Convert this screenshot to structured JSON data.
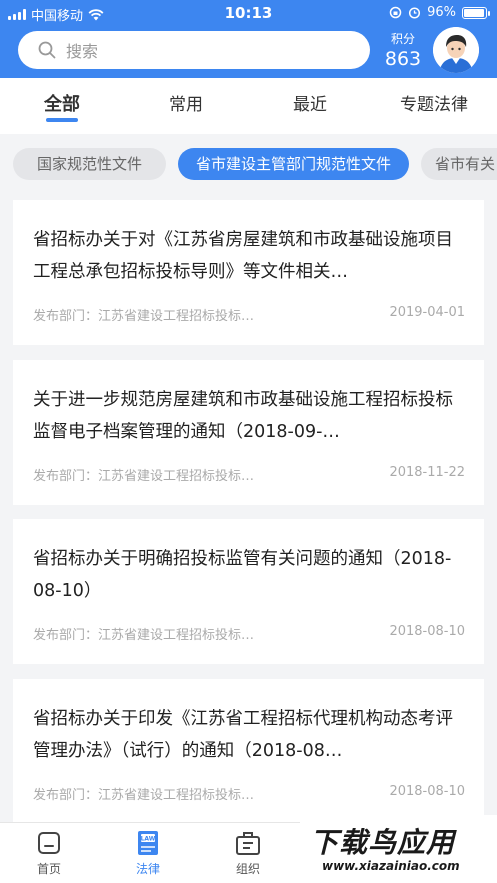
{
  "status_bar": {
    "carrier": "中国移动",
    "time": "10:13",
    "battery": "96%",
    "battery_level": 0.96
  },
  "search": {
    "placeholder": "搜索"
  },
  "points": {
    "label": "积分",
    "value": "863"
  },
  "tabs": [
    {
      "label": "全部",
      "active": true
    },
    {
      "label": "常用",
      "active": false
    },
    {
      "label": "最近",
      "active": false
    },
    {
      "label": "专题法律",
      "active": false
    }
  ],
  "categories": [
    {
      "label": "国家规范性文件",
      "active": false
    },
    {
      "label": "省市建设主管部门规范性文件",
      "active": true
    },
    {
      "label": "省市有关",
      "active": false
    }
  ],
  "documents": [
    {
      "title": "省招标办关于对《江苏省房屋建筑和市政基础设施项目工程总承包招标投标导则》等文件相关…",
      "dept": "发布部门：江苏省建设工程招标投标…",
      "date": "2019-04-01"
    },
    {
      "title": "关于进一步规范房屋建筑和市政基础设施工程招标投标监督电子档案管理的通知（2018-09-…",
      "dept": "发布部门：江苏省建设工程招标投标…",
      "date": "2018-11-22"
    },
    {
      "title": "省招标办关于明确招投标监管有关问题的通知（2018-08-10）",
      "dept": "发布部门：江苏省建设工程招标投标…",
      "date": "2018-08-10"
    },
    {
      "title": "省招标办关于印发《江苏省工程招标代理机构动态考评管理办法》（试行）的通知（2018-08…",
      "dept": "发布部门：江苏省建设工程招标投标…",
      "date": "2018-08-10"
    }
  ],
  "bottom_nav": [
    {
      "label": "首页",
      "icon": "home-icon",
      "active": false
    },
    {
      "label": "法律",
      "icon": "law-book-icon",
      "active": true,
      "icon_text": "LAW"
    },
    {
      "label": "组织",
      "icon": "organization-icon",
      "active": false
    }
  ],
  "watermark": {
    "main": "下载鸟应用",
    "url": "www.xiazainiao.com"
  },
  "colors": {
    "accent": "#3d86f0",
    "background": "#f3f4f6",
    "text": "#222222",
    "muted": "#aaaaaa"
  }
}
